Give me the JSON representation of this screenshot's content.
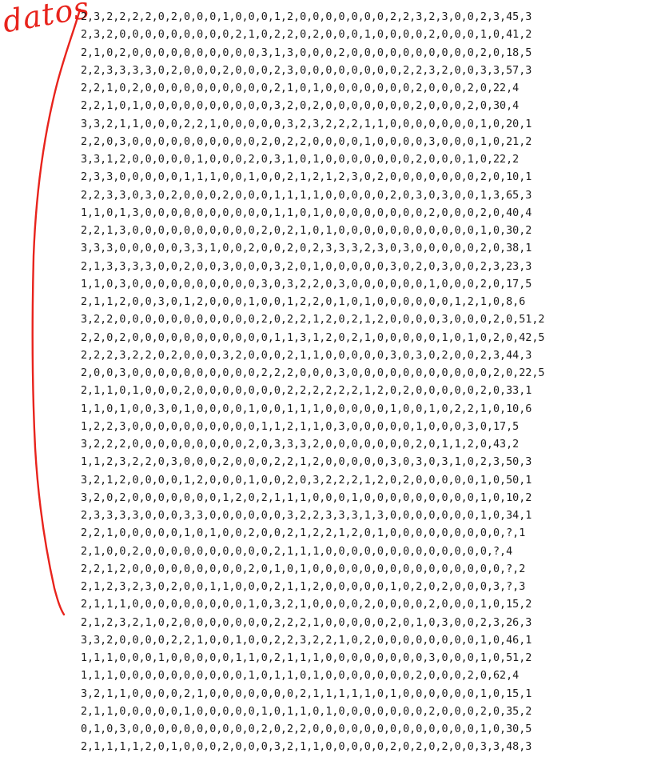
{
  "annotation": {
    "label": "datos",
    "color": "#e8231c"
  },
  "lines": [
    "2,3,2,2,2,2,0,2,0,0,0,1,0,0,0,1,2,0,0,0,0,0,0,0,2,2,3,2,3,0,0,2,3,45,3",
    "2,3,2,0,0,0,0,0,0,0,0,0,2,1,0,2,2,0,2,0,0,0,1,0,0,0,0,2,0,0,0,1,0,41,2",
    "2,1,0,2,0,0,0,0,0,0,0,0,0,0,3,1,3,0,0,0,2,0,0,0,0,0,0,0,0,0,0,2,0,18,5",
    "2,2,3,3,3,3,0,2,0,0,0,2,0,0,0,2,3,0,0,0,0,0,0,0,0,2,2,3,2,0,0,3,3,57,3",
    "2,2,1,0,2,0,0,0,0,0,0,0,0,0,0,2,1,0,1,0,0,0,0,0,0,0,2,0,0,0,2,0,22,4",
    "2,2,1,0,1,0,0,0,0,0,0,0,0,0,0,3,2,0,2,0,0,0,0,0,0,0,2,0,0,0,2,0,30,4",
    "3,3,2,1,1,0,0,0,2,2,1,0,0,0,0,0,3,2,3,2,2,2,1,1,0,0,0,0,0,0,0,1,0,20,1",
    "2,2,0,3,0,0,0,0,0,0,0,0,0,0,2,0,2,2,0,0,0,0,1,0,0,0,0,3,0,0,0,1,0,21,2",
    "3,3,1,2,0,0,0,0,0,1,0,0,0,2,0,3,1,0,1,0,0,0,0,0,0,0,2,0,0,0,1,0,22,2",
    "2,3,3,0,0,0,0,0,1,1,1,0,0,1,0,0,2,1,2,1,2,3,0,2,0,0,0,0,0,0,0,2,0,10,1",
    "2,2,3,3,0,3,0,2,0,0,0,2,0,0,0,1,1,1,1,0,0,0,0,0,2,0,3,0,3,0,0,1,3,65,3",
    "1,1,0,1,3,0,0,0,0,0,0,0,0,0,0,1,1,0,1,0,0,0,0,0,0,0,0,2,0,0,0,2,0,40,4",
    "2,2,1,3,0,0,0,0,0,0,0,0,0,0,2,0,2,1,0,1,0,0,0,0,0,0,0,0,0,0,0,1,0,30,2",
    "3,3,3,0,0,0,0,0,3,3,1,0,0,2,0,0,2,0,2,3,3,3,2,3,0,3,0,0,0,0,0,2,0,38,1",
    "2,1,3,3,3,3,0,0,2,0,0,3,0,0,0,3,2,0,1,0,0,0,0,0,3,0,2,0,3,0,0,2,3,23,3",
    "1,1,0,3,0,0,0,0,0,0,0,0,0,0,3,0,3,2,2,0,3,0,0,0,0,0,0,1,0,0,0,2,0,17,5",
    "2,1,1,2,0,0,3,0,1,2,0,0,0,1,0,0,1,2,2,0,1,0,1,0,0,0,0,0,0,1,2,1,0,8,6",
    "3,2,2,0,0,0,0,0,0,0,0,0,0,0,2,0,2,2,1,2,0,2,1,2,0,0,0,0,3,0,0,0,2,0,51,2",
    "2,2,0,2,0,0,0,0,0,0,0,0,0,0,0,1,1,3,1,2,0,2,1,0,0,0,0,0,1,0,1,0,2,0,42,5",
    "2,2,2,3,2,2,0,2,0,0,0,3,2,0,0,0,2,1,1,0,0,0,0,0,3,0,3,0,2,0,0,2,3,44,3",
    "2,0,0,3,0,0,0,0,0,0,0,0,0,0,2,2,2,0,0,0,3,0,0,0,0,0,0,0,0,0,0,0,2,0,22,5",
    "2,1,1,0,1,0,0,0,2,0,0,0,0,0,0,0,2,2,2,2,2,2,1,2,0,2,0,0,0,0,0,2,0,33,1",
    "1,1,0,1,0,0,3,0,1,0,0,0,0,1,0,0,1,1,1,0,0,0,0,0,1,0,0,1,0,2,2,1,0,10,6",
    "1,2,2,3,0,0,0,0,0,0,0,0,0,0,1,1,2,1,1,0,3,0,0,0,0,0,1,0,0,0,3,0,17,5",
    "3,2,2,2,0,0,0,0,0,0,0,0,0,2,0,3,3,3,2,0,0,0,0,0,0,0,2,0,1,1,2,0,43,2",
    "1,1,2,3,2,2,0,3,0,0,0,2,0,0,0,2,2,1,2,0,0,0,0,0,3,0,3,0,3,1,0,2,3,50,3",
    "3,2,1,2,0,0,0,0,1,2,0,0,0,1,0,0,2,0,3,2,2,2,1,2,0,2,0,0,0,0,0,1,0,50,1",
    "3,2,0,2,0,0,0,0,0,0,0,1,2,0,2,1,1,1,0,0,0,1,0,0,0,0,0,0,0,0,0,1,0,10,2",
    "2,3,3,3,3,0,0,0,3,3,0,0,0,0,0,0,3,2,2,3,3,3,1,3,0,0,0,0,0,0,0,1,0,34,1",
    "2,2,1,0,0,0,0,0,1,0,1,0,0,2,0,0,2,1,2,2,1,2,0,1,0,0,0,0,0,0,0,0,0,?,1",
    "2,1,0,0,2,0,0,0,0,0,0,0,0,0,0,2,1,1,1,0,0,0,0,0,0,0,0,0,0,0,0,0,?,4",
    "2,2,1,2,0,0,0,0,0,0,0,0,0,2,0,1,0,1,0,0,0,0,0,0,0,0,0,0,0,0,0,0,0,?,2",
    "2,1,2,3,2,3,0,2,0,0,1,1,0,0,0,2,1,1,2,0,0,0,0,0,1,0,2,0,2,0,0,0,3,?,3",
    "2,1,1,1,0,0,0,0,0,0,0,0,0,1,0,3,2,1,0,0,0,0,2,0,0,0,0,2,0,0,0,1,0,15,2",
    "2,1,2,3,2,1,0,2,0,0,0,0,0,0,0,2,2,2,1,0,0,0,0,0,2,0,1,0,3,0,0,2,3,26,3",
    "3,3,2,0,0,0,0,2,2,1,0,0,1,0,0,2,2,3,2,2,1,0,2,0,0,0,0,0,0,0,0,1,0,46,1",
    "1,1,1,0,0,0,1,0,0,0,0,0,1,1,0,2,1,1,1,0,0,0,0,0,0,0,0,3,0,0,0,1,0,51,2",
    "1,1,1,0,0,0,0,0,0,0,0,0,0,1,0,1,1,0,1,0,0,0,0,0,0,0,2,0,0,0,2,0,62,4",
    "3,2,1,1,0,0,0,0,2,1,0,0,0,0,0,0,0,2,1,1,1,1,1,0,1,0,0,0,0,0,0,1,0,15,1",
    "2,1,1,0,0,0,0,0,1,0,0,0,0,0,1,0,1,1,0,1,0,0,0,0,0,0,0,2,0,0,0,2,0,35,2",
    "0,1,0,3,0,0,0,0,0,0,0,0,0,0,2,0,2,2,0,0,0,0,0,0,0,0,0,0,0,0,0,1,0,30,5",
    "2,1,1,1,1,2,0,1,0,0,0,2,0,0,0,3,2,1,1,0,0,0,0,0,2,0,2,0,2,0,0,3,3,48,3"
  ]
}
